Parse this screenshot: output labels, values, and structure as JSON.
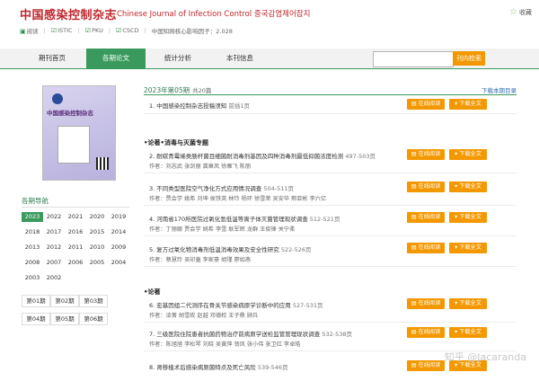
{
  "header": {
    "title_cn": "中国感染控制杂志",
    "title_en": "Chinese Journal of Infection Control 중국감염제어잡지",
    "favorite": "收藏",
    "tags": [
      "阅读",
      "ISTIC",
      "PKU",
      "CSCD"
    ],
    "impact": "中国知网核心影响因子：2.028"
  },
  "nav": {
    "tabs": [
      "期刊首页",
      "各期论文",
      "统计分析",
      "本刊信息"
    ],
    "active": 1,
    "search_button": "刊内检索",
    "search_placeholder": ""
  },
  "cover": {
    "title": "中国感染控制杂志"
  },
  "sidebar": {
    "title": "各期导航",
    "years": [
      "2023",
      "2022",
      "2021",
      "2020",
      "2019",
      "2018",
      "2017",
      "2016",
      "2015",
      "2014",
      "2013",
      "2012",
      "2011",
      "2010",
      "2009",
      "2008",
      "2007",
      "2006",
      "2005",
      "2004",
      "2003",
      "2002"
    ],
    "active_year": "2023",
    "issues": [
      "第01期",
      "第02期",
      "第03期",
      "第04期",
      "第05期",
      "第06期"
    ]
  },
  "main": {
    "issue_title": "2023年第05期",
    "count": "共20篇",
    "download_dir": "下载本期目录",
    "read_label": "在线阅读",
    "download_label": "下载全文",
    "items": [
      {
        "num": "1.",
        "title": "中国感染控制杂志投稿须知",
        "pages": "前插1页",
        "authors": "",
        "section": ""
      },
      {
        "num": "2.",
        "title": "耐碳青霉烯类肠杆菌目细菌耐消毒剂基因及四种消毒剂最低抑菌浓度检测",
        "pages": "497-503页",
        "authors": "作者：刘志武  张剑丽  龚章凤  徐雁飞  陈丽",
        "section": "•论著•消毒与灭菌专题"
      },
      {
        "num": "3.",
        "title": "不同类型医院空气净化方式应用情况调查",
        "pages": "504-511页",
        "authors": "作者：贾会学  姚希  刘坤  侯铁英  林玲  杨环  徐雪荣  吴安华  邢亚彬  李六亿",
        "section": ""
      },
      {
        "num": "4.",
        "title": "河南省170所医院过氧化氢低温等离子体灭菌管理现状调查",
        "pages": "512-521页",
        "authors": "作者：丁丽娜  贾会学  姚希  李雪  耿军辉  龙群  王俊锋  关宁柔",
        "section": ""
      },
      {
        "num": "5.",
        "title": "复方过氧化物消毒剂低温消毒效果及安全性研究",
        "pages": "522-526页",
        "authors": "作者：蔡慧玲  吴印童  李家豪  胡瑾  廖如燕",
        "section": ""
      },
      {
        "num": "6.",
        "title": "宏基因组二代测序在骨关节感染病原学诊断中的应用",
        "pages": "527-531页",
        "authors": "作者：凌菁  胡雪玫  赵越  邓德权  王子鼎  顾兵",
        "section": "•论著"
      },
      {
        "num": "7.",
        "title": "三级医院住院患者抗菌药物治疗前病原学送检监管管理现状调查",
        "pages": "532-538页",
        "authors": "作者：陈旭旭  李松琴  刘晓  吴黄萍  翁凤  张小伟  张卫红  李卓皓",
        "section": ""
      },
      {
        "num": "8.",
        "title": "肾移植术后感染病原菌特点及死亡风险",
        "pages": "539-546页",
        "authors": "",
        "section": ""
      }
    ]
  },
  "watermark": "知乎 @Jacaranda"
}
